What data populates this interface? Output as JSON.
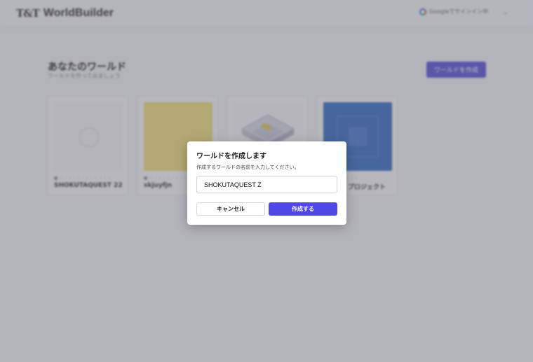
{
  "header": {
    "logo_mark": "T&T",
    "logo_text": "WorldBuilder",
    "login_label": "Googleでサインイン中"
  },
  "main": {
    "title": "あなたのワールド",
    "subtitle": "ワールドを作ってみましょう",
    "create_button": "ワールドを作成"
  },
  "cards": [
    {
      "name": "SHOKUTAQUEST 22",
      "meta": "・・・・・・・・・ ・・・"
    },
    {
      "name": "skjuyfjn",
      "meta": "・・・・・・・・・ ・・・"
    },
    {
      "name": "",
      "meta": ""
    },
    {
      "name": "プロジェクト",
      "meta": "・・・"
    }
  ],
  "modal": {
    "title": "ワールドを作成します",
    "description": "作成するワールドの名前を入力してください。",
    "input_value": "SHOKUTAQUEST Z",
    "cancel_label": "キャンセル",
    "confirm_label": "作成する"
  },
  "colors": {
    "accent": "#5048e5",
    "overlay": "#5a5a69"
  }
}
